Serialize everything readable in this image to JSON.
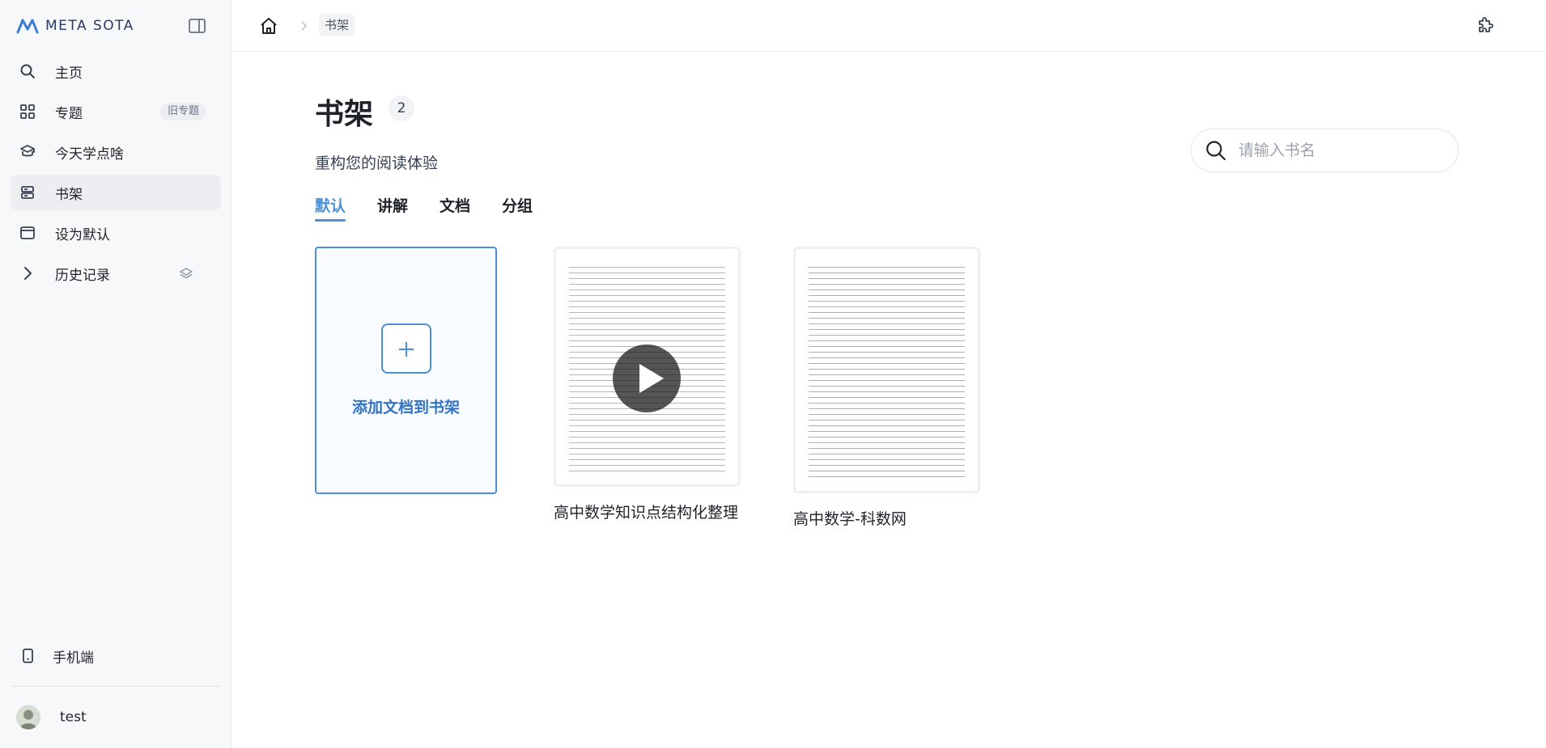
{
  "brand": {
    "name": "META SOTA"
  },
  "sidebar": {
    "items": [
      {
        "label": "主页",
        "icon": "search-icon"
      },
      {
        "label": "专题",
        "icon": "grid-icon",
        "badge": "旧专题"
      },
      {
        "label": "今天学点啥",
        "icon": "stack-icon"
      },
      {
        "label": "书架",
        "icon": "shelf-icon",
        "active": true
      },
      {
        "label": "设为默认",
        "icon": "window-icon"
      },
      {
        "label": "历史记录",
        "icon": "chevron-right-icon"
      }
    ],
    "mobile_label": "手机端",
    "user_name": "test"
  },
  "topbar": {
    "breadcrumb": "书架"
  },
  "main": {
    "title": "书架",
    "count": "2",
    "subtitle": "重构您的阅读体验",
    "search_placeholder": "请输入书名",
    "tabs": [
      {
        "label": "默认",
        "active": true
      },
      {
        "label": "讲解"
      },
      {
        "label": "文档"
      },
      {
        "label": "分组"
      }
    ],
    "add_card_label": "添加文档到书架",
    "books": [
      {
        "title": "高中数学知识点结构化整理"
      },
      {
        "title": "高中数学-科数网"
      }
    ]
  },
  "colors": {
    "accent": "#4a90d9",
    "sidebar_bg": "#f7f8fa",
    "brand": "#2b3a67"
  }
}
